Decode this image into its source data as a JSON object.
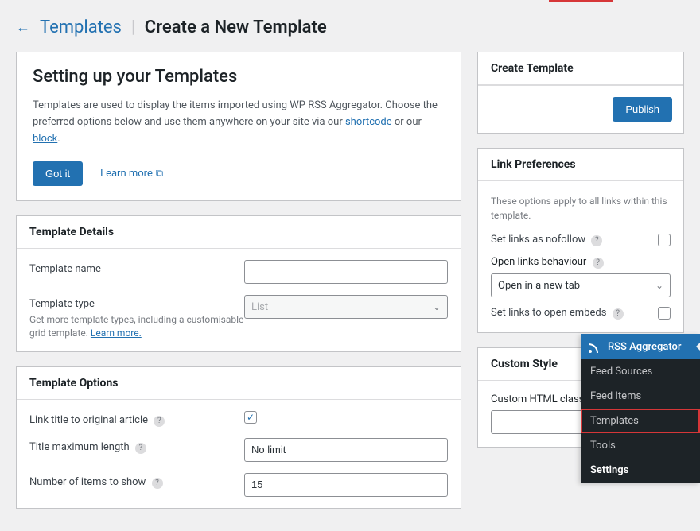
{
  "header": {
    "back_label": "Templates",
    "page_title": "Create a New Template"
  },
  "intro": {
    "heading": "Setting up your Templates",
    "text_before": "Templates are used to display the items imported using WP RSS Aggregator. Choose the preferred options below and use them anywhere on your site via our ",
    "shortcode_link": "shortcode",
    "text_mid": " or our ",
    "block_link": "block",
    "text_end": ".",
    "gotit": "Got it",
    "learn_more": "Learn more"
  },
  "details": {
    "panel_title": "Template Details",
    "name_label": "Template name",
    "name_value": "",
    "type_label": "Template type",
    "type_value": "List",
    "type_help_before": "Get more template types, including a customisable grid template. ",
    "type_help_link": "Learn more."
  },
  "options": {
    "panel_title": "Template Options",
    "link_title_label": "Link title to original article",
    "link_title_checked": true,
    "max_len_label": "Title maximum length",
    "max_len_value": "No limit",
    "num_items_label": "Number of items to show",
    "num_items_value": "15"
  },
  "side": {
    "create_title": "Create Template",
    "publish": "Publish",
    "link_prefs_title": "Link Preferences",
    "link_prefs_desc": "These options apply to all links within this template.",
    "nofollow_label": "Set links as nofollow",
    "open_behaviour_label": "Open links behaviour",
    "open_behaviour_value": "Open in a new tab",
    "embeds_label": "Set links to open embeds",
    "custom_style_title": "Custom Style",
    "custom_class_label": "Custom HTML class"
  },
  "overlay_menu": {
    "header": "RSS Aggregator",
    "items": [
      "Feed Sources",
      "Feed Items",
      "Templates",
      "Tools",
      "Settings"
    ],
    "selected_index": 2,
    "bold_index": 4
  }
}
